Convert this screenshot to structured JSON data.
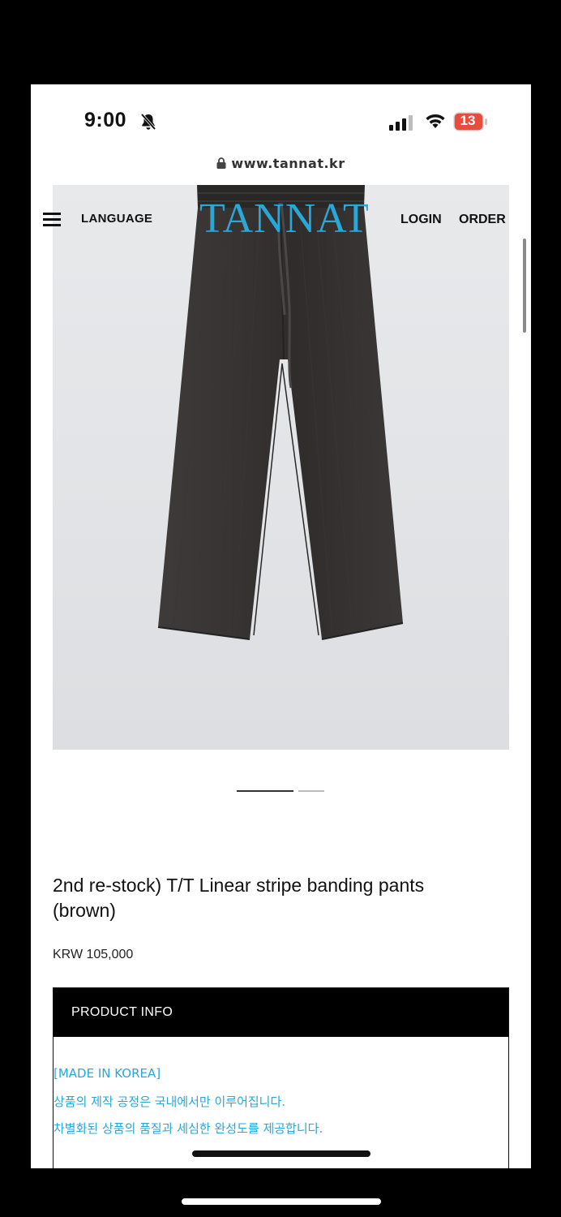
{
  "status_bar": {
    "time": "9:00",
    "battery": "13",
    "battery_color": "#e74c3c"
  },
  "browser": {
    "url": "www.tannat.kr"
  },
  "nav": {
    "language_label": "LANGUAGE",
    "logo_text": "TANNAT",
    "login_label": "LOGIN",
    "order_label": "ORDER",
    "logo_color": "#29a7d8",
    "menu_icon": "hamburger-icon"
  },
  "product": {
    "title": "2nd re-stock) T/T Linear stripe banding pants (brown)",
    "price": "KRW 105,000",
    "image_subject": "pants-image",
    "carousel": {
      "active_index": 0,
      "count": 2
    }
  },
  "product_info": {
    "header": "PRODUCT INFO",
    "lines": [
      "[MADE IN KOREA]",
      "상품의 제작 공정은 국내에서만 이루어집니다.",
      "차별화된 상품의 품질과 세심한 완성도를 제공합니다."
    ],
    "text_color": "#29a7d8"
  }
}
